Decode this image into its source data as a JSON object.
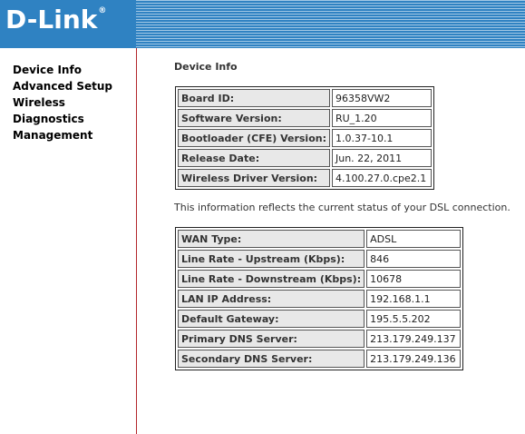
{
  "brand": {
    "logo_text": "D-Link",
    "registered_mark": "®"
  },
  "sidebar": {
    "items": [
      {
        "label": "Device Info"
      },
      {
        "label": "Advanced Setup"
      },
      {
        "label": "Wireless"
      },
      {
        "label": "Diagnostics"
      },
      {
        "label": "Management"
      }
    ]
  },
  "main": {
    "title": "Device Info",
    "device_table": [
      {
        "label": "Board ID:",
        "value": "96358VW2"
      },
      {
        "label": "Software Version:",
        "value": "RU_1.20"
      },
      {
        "label": "Bootloader (CFE) Version:",
        "value": "1.0.37-10.1"
      },
      {
        "label": "Release Date:",
        "value": "Jun. 22, 2011"
      },
      {
        "label": "Wireless Driver Version:",
        "value": "4.100.27.0.cpe2.1"
      }
    ],
    "note": "This information reflects the current status of your DSL connection.",
    "wan_table": [
      {
        "label": "WAN Type:",
        "value": "ADSL"
      },
      {
        "label": "Line Rate - Upstream (Kbps):",
        "value": "846"
      },
      {
        "label": "Line Rate - Downstream (Kbps):",
        "value": "10678"
      },
      {
        "label": "LAN IP Address:",
        "value": "192.168.1.1"
      },
      {
        "label": "Default Gateway:",
        "value": "195.5.5.202"
      },
      {
        "label": "Primary DNS Server:",
        "value": "213.179.249.137"
      },
      {
        "label": "Secondary DNS Server:",
        "value": "213.179.249.136"
      }
    ]
  },
  "colors": {
    "banner": "#2f82c2",
    "divider": "#b3262b",
    "label_cell": "#e8e8e8"
  }
}
